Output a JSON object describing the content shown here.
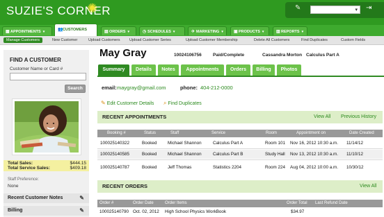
{
  "app": {
    "logo_text": "SUZIE'S CORNER",
    "logout_label": "⇥"
  },
  "nav": {
    "tabs": [
      {
        "label": "APPOINTMENTS"
      },
      {
        "label": "CUSTOMERS"
      },
      {
        "label": "ORDERS"
      },
      {
        "label": "SCHEDULES"
      },
      {
        "label": "MARKETING"
      },
      {
        "label": "PRODUCTS"
      },
      {
        "label": "REPORTS"
      }
    ],
    "subitems": [
      {
        "label": "Manage Customers"
      },
      {
        "label": "New Customer"
      },
      {
        "label": "Upload Customers"
      },
      {
        "label": "Upload Customer Series"
      },
      {
        "label": "Upload Customer Membership"
      },
      {
        "label": "Delete All Customers"
      },
      {
        "label": "Find Duplicates"
      },
      {
        "label": "Custom Fields"
      }
    ]
  },
  "sidebar": {
    "find_title": "FIND A CUSTOMER",
    "input_label": "Customer Name or Card #",
    "input_value": "",
    "search_label": "Search",
    "total_sales_label": "Total Sales:",
    "total_sales_value": "$444.15",
    "total_service_label": "Total Service Sales:",
    "total_service_value": "$409.18",
    "pref_label": "Staff Preference:",
    "pref_value": "None",
    "sections": [
      {
        "label": "Recent Customer Notes"
      },
      {
        "label": "Billing"
      }
    ]
  },
  "customer": {
    "name": "May Gray",
    "id": "10024106756",
    "status": "Paid/Complete",
    "staff": "Cassandra Morton",
    "package": "Calculus Part A",
    "email_label": "email:",
    "email": "maygray@gmail.com",
    "phone_label": "phone:",
    "phone": "404-212-0000",
    "edit_label": "Edit Customer Details",
    "dup_label": "Find Duplicates"
  },
  "profile_tabs": [
    {
      "label": "Summary"
    },
    {
      "label": "Details"
    },
    {
      "label": "Notes"
    },
    {
      "label": "Appointments"
    },
    {
      "label": "Orders"
    },
    {
      "label": "Billing"
    },
    {
      "label": "Photos"
    }
  ],
  "appointments": {
    "title": "RECENT APPOINTMENTS",
    "view_all": "View All",
    "previous": "Previous History",
    "columns": [
      "Booking #",
      "Status",
      "Staff",
      "Service",
      "Room",
      "Appointment on",
      "Date Created"
    ],
    "rows": [
      [
        "100025140322",
        "Booked",
        "Michael Shannon",
        "Calculus Part A",
        "Room 101",
        "Nov 16, 2012 10:30 a.m.",
        "11/14/12"
      ],
      [
        "100025140585",
        "Booked",
        "Michael Shannon",
        "Calculus Part B",
        "Study Hall",
        "Nov 13, 2012 10:30 a.m.",
        "11/10/12"
      ],
      [
        "100025140787",
        "Booked",
        "Jeff Thomas",
        "Statistics 2204",
        "Room 224",
        "Aug 04, 2012 10:00 a.m.",
        "10/30/12"
      ]
    ]
  },
  "orders": {
    "title": "RECENT ORDERS",
    "view_all": "View All",
    "columns": [
      "Order #",
      "Order Date",
      "Order Items",
      "Order Total",
      "Last Refund Date"
    ],
    "rows": [
      [
        "100025140790",
        "Oct. 02, 2012",
        "High School Physics WorkBook",
        "$34.97",
        ""
      ]
    ]
  },
  "colors": {
    "brand_green": "#2f9a20",
    "link_green": "#2b8a1e",
    "sales_yellow": "#f4f0a0"
  }
}
